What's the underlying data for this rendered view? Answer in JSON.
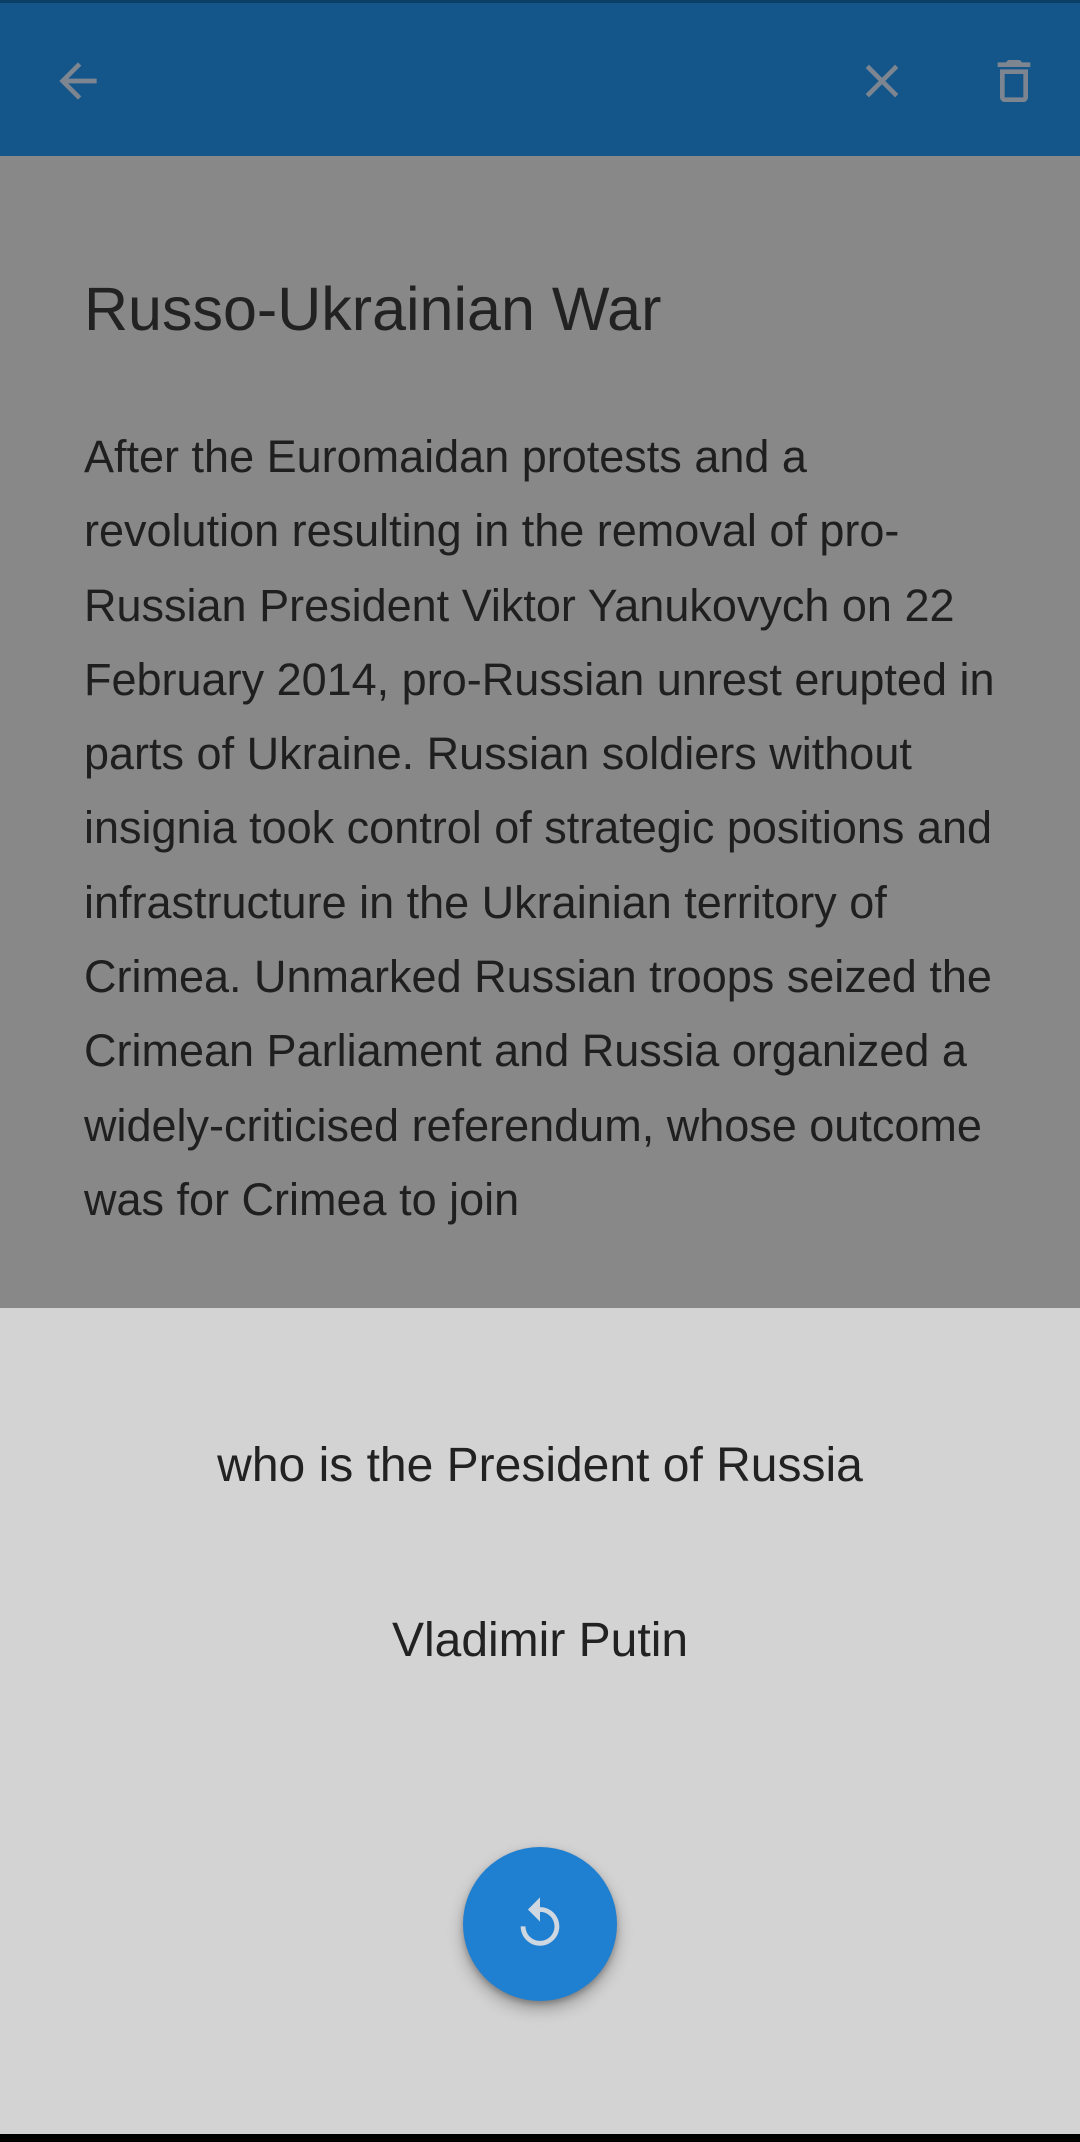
{
  "toolbar": {
    "back_icon": "arrow-back-icon",
    "close_icon": "close-icon",
    "delete_icon": "trash-icon"
  },
  "article": {
    "title": "Russo-Ukrainian War",
    "body": "After the Euromaidan protests and a revolution resulting in the removal of pro-Russian President Viktor Yanukovych on 22 February 2014, pro-Russian unrest erupted in parts of Ukraine. Russian soldiers without insignia took control of strategic positions and infrastructure in the Ukrainian territory of Crimea. Unmarked Russian troops seized the Crimean Parliament and Russia organized a widely-criticised referendum, whose outcome was for Crimea to join"
  },
  "card": {
    "question": "who is the President of Russia",
    "answer": "Vladimir Putin",
    "action_icon": "refresh-icon"
  },
  "colors": {
    "appbar": "#14568a",
    "fab": "#1f7fd1",
    "sheet": "#d3d3d3",
    "scrim": "#888888"
  }
}
